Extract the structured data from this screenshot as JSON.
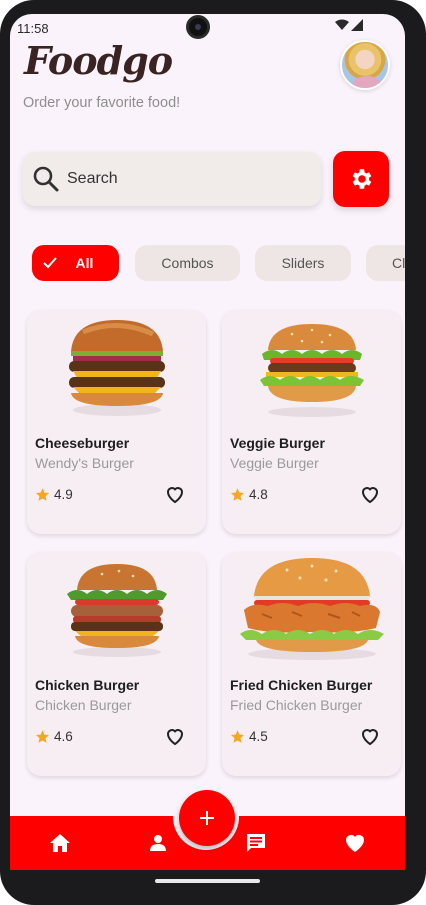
{
  "status": {
    "time": "11:58"
  },
  "header": {
    "brand": "Foodgo",
    "tagline": "Order your favorite food!"
  },
  "search": {
    "placeholder": "Search"
  },
  "categories": [
    {
      "label": "All",
      "selected": true
    },
    {
      "label": "Combos",
      "selected": false
    },
    {
      "label": "Sliders",
      "selected": false
    },
    {
      "label": "Cl",
      "selected": false
    }
  ],
  "products": [
    {
      "name": "Cheeseburger",
      "brand": "Wendy's Burger",
      "rating": "4.9",
      "image": "cheeseburger-image"
    },
    {
      "name": "Veggie Burger",
      "brand": "Veggie Burger",
      "rating": "4.8",
      "image": "veggie-burger-image"
    },
    {
      "name": "Chicken Burger",
      "brand": "Chicken Burger",
      "rating": "4.6",
      "image": "chicken-burger-image"
    },
    {
      "name": "Fried Chicken Burger",
      "brand": "Fried Chicken Burger",
      "rating": "4.5",
      "image": "fried-chicken-burger-image"
    }
  ],
  "nav": {
    "items": [
      "home-icon",
      "profile-icon",
      "chat-icon",
      "heart-icon"
    ],
    "fab": "plus-icon"
  },
  "colors": {
    "accent": "#ff0000",
    "background": "#fbf3fb",
    "brand_text": "#3a2323",
    "star": "#f5a623"
  }
}
